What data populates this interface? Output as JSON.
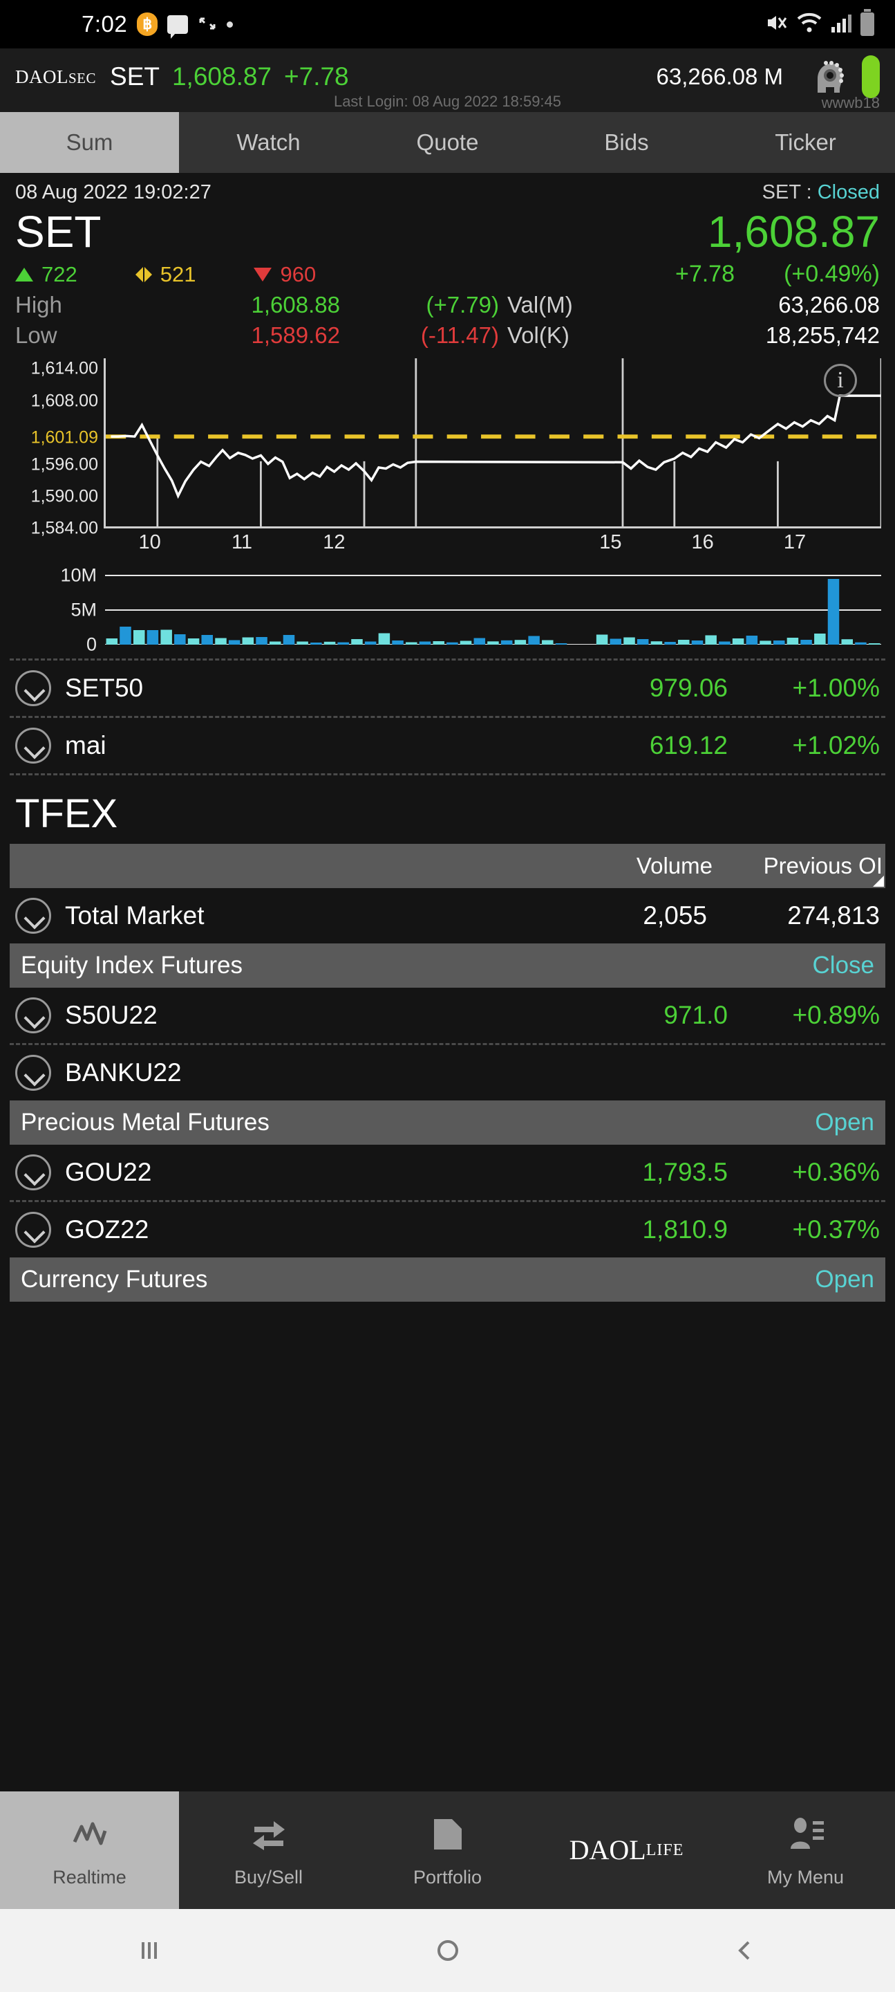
{
  "status_bar": {
    "time": "7:02",
    "icons": [
      "coin-icon",
      "chat-icon",
      "arrow-icon",
      "dot-icon",
      "mute-icon",
      "wifi-icon",
      "signal-icon",
      "battery-icon"
    ]
  },
  "app_header": {
    "logo_main": "DAOL",
    "logo_sub": "SEC",
    "index_name": "SET",
    "index_value": "1,608.87",
    "index_change": "+7.78",
    "turnover": "63,266.08 M",
    "last_login": "Last Login: 08 Aug 2022 18:59:45",
    "username": "wwwb18",
    "status_color": "#7ed321"
  },
  "tabs": [
    {
      "label": "Sum",
      "active": true
    },
    {
      "label": "Watch",
      "active": false
    },
    {
      "label": "Quote",
      "active": false
    },
    {
      "label": "Bids",
      "active": false
    },
    {
      "label": "Ticker",
      "active": false
    }
  ],
  "quote": {
    "timestamp": "08 Aug 2022 19:02:27",
    "market_label": "SET :",
    "market_status": "Closed",
    "name": "SET",
    "last": "1,608.87",
    "advances": "722",
    "unchanged": "521",
    "declines": "960",
    "change": "+7.78",
    "change_pct": "(+0.49%)",
    "high_label": "High",
    "high_value": "1,608.88",
    "high_change": "(+7.79)",
    "low_label": "Low",
    "low_value": "1,589.62",
    "low_change": "(-11.47)",
    "val_label": "Val(M)",
    "val_value": "63,266.08",
    "vol_label": "Vol(K)",
    "vol_value": "18,255,742",
    "up_color": "#4cd137",
    "down_color": "#e03b3b",
    "flat_color": "#e8c32a"
  },
  "chart_data": [
    {
      "type": "line",
      "title": "SET intraday",
      "xlabel": "",
      "ylabel": "",
      "ylim": [
        1584.0,
        1616.0
      ],
      "yticks": [
        1614.0,
        1608.0,
        1601.09,
        1596.0,
        1590.0,
        1584.0
      ],
      "ytick_labels": [
        "1,614.00",
        "1,608.00",
        "1,601.09",
        "1,596.00",
        "1,590.00",
        "1,584.00"
      ],
      "prev_close": 1601.09,
      "prev_close_label": "1,601.09",
      "xticks": [
        10,
        11,
        12,
        15,
        16,
        17
      ],
      "xtick_labels": [
        "10",
        "11",
        "12",
        "15",
        "16",
        "17"
      ],
      "grid": false,
      "legend": null,
      "session_breaks": [
        10,
        11,
        12,
        12.5,
        14.5,
        15,
        16,
        17
      ],
      "x": [
        9.55,
        9.62,
        9.7,
        9.78,
        9.85,
        9.93,
        10.0,
        10.07,
        10.14,
        10.2,
        10.27,
        10.35,
        10.42,
        10.5,
        10.57,
        10.63,
        10.7,
        10.78,
        10.85,
        10.92,
        11.0,
        11.07,
        11.14,
        11.21,
        11.28,
        11.35,
        11.42,
        11.5,
        11.57,
        11.64,
        11.71,
        11.78,
        11.85,
        11.92,
        12.0,
        12.07,
        12.14,
        12.21,
        12.28,
        12.35,
        12.42,
        12.5,
        14.5,
        14.58,
        14.66,
        14.74,
        14.82,
        14.9,
        15.0,
        15.08,
        15.16,
        15.24,
        15.32,
        15.4,
        15.5,
        15.58,
        15.66,
        15.74,
        15.82,
        15.9,
        16.0,
        16.08,
        16.16,
        16.24,
        16.32,
        16.4,
        16.48,
        16.55,
        16.6,
        17.0
      ],
      "y": [
        1601.1,
        1601.1,
        1601.2,
        1601.1,
        1603.3,
        1600.2,
        1597.5,
        1595.0,
        1592.7,
        1589.8,
        1592.6,
        1594.8,
        1596.3,
        1595.5,
        1597.2,
        1598.5,
        1597.0,
        1598.0,
        1597.6,
        1596.9,
        1597.5,
        1595.9,
        1597.1,
        1596.3,
        1593.2,
        1594.0,
        1593.0,
        1594.2,
        1593.5,
        1595.3,
        1594.4,
        1595.6,
        1594.8,
        1596.0,
        1594.5,
        1592.8,
        1595.2,
        1595.0,
        1595.8,
        1595.2,
        1596.1,
        1596.3,
        1596.2,
        1595.0,
        1596.5,
        1595.3,
        1594.8,
        1596.2,
        1596.9,
        1598.0,
        1597.2,
        1598.8,
        1598.2,
        1600.0,
        1599.0,
        1600.6,
        1600.0,
        1601.5,
        1600.8,
        1602.0,
        1603.5,
        1602.6,
        1603.8,
        1603.0,
        1604.2,
        1603.5,
        1605.0,
        1604.2,
        1608.87,
        1608.87
      ],
      "line_color": "#ffffff",
      "prev_close_color": "#e8c32a",
      "info_badge": "i"
    },
    {
      "type": "bar",
      "title": "Volume",
      "ylim": [
        0,
        11000000
      ],
      "yticks": [
        10000000,
        5000000,
        0
      ],
      "ytick_labels": [
        "10M",
        "5M",
        "0"
      ],
      "bar_colors_alternating": [
        "#6fe0de",
        "#2196d8"
      ],
      "values": [
        900000,
        2600000,
        2100000,
        2100000,
        2150000,
        1500000,
        900000,
        1400000,
        950000,
        650000,
        1050000,
        1100000,
        450000,
        1400000,
        450000,
        300000,
        420000,
        340000,
        800000,
        450000,
        1650000,
        600000,
        350000,
        450000,
        500000,
        330000,
        550000,
        950000,
        470000,
        620000,
        680000,
        1250000,
        650000,
        200000,
        0,
        0,
        1450000,
        850000,
        1050000,
        800000,
        480000,
        400000,
        700000,
        600000,
        1350000,
        450000,
        900000,
        1300000,
        560000,
        600000,
        1000000,
        700000,
        1600000,
        9500000,
        780000,
        330000,
        120000
      ]
    }
  ],
  "index_rows": [
    {
      "name": "SET50",
      "value": "979.06",
      "change_pct": "+1.00%"
    },
    {
      "name": "mai",
      "value": "619.12",
      "change_pct": "+1.02%"
    }
  ],
  "tfex": {
    "title": "TFEX",
    "columns": {
      "volume": "Volume",
      "previous_oi": "Previous OI"
    },
    "total_market": {
      "name": "Total Market",
      "volume": "2,055",
      "previous_oi": "274,813"
    },
    "groups": [
      {
        "name": "Equity Index Futures",
        "status": "Close",
        "rows": [
          {
            "name": "S50U22",
            "value": "971.0",
            "change_pct": "+0.89%"
          },
          {
            "name": "BANKU22",
            "value": "",
            "change_pct": ""
          }
        ]
      },
      {
        "name": "Precious Metal Futures",
        "status": "Open",
        "rows": [
          {
            "name": "GOU22",
            "value": "1,793.5",
            "change_pct": "+0.36%"
          },
          {
            "name": "GOZ22",
            "value": "1,810.9",
            "change_pct": "+0.37%"
          }
        ]
      },
      {
        "name": "Currency Futures",
        "status": "Open",
        "rows": []
      }
    ]
  },
  "bottom_nav": [
    {
      "label": "Realtime",
      "icon": "chart-line-icon",
      "active": true
    },
    {
      "label": "Buy/Sell",
      "icon": "exchange-arrows-icon",
      "active": false
    },
    {
      "label": "Portfolio",
      "icon": "folder-icon",
      "active": false
    },
    {
      "label": "",
      "icon": "daol-life-logo",
      "logo_main": "DAOL",
      "logo_sub": "LIFE",
      "active": false
    },
    {
      "label": "My Menu",
      "icon": "person-list-icon",
      "active": false
    }
  ],
  "android_nav": [
    {
      "icon": "recents-icon"
    },
    {
      "icon": "home-icon"
    },
    {
      "icon": "back-icon"
    }
  ]
}
